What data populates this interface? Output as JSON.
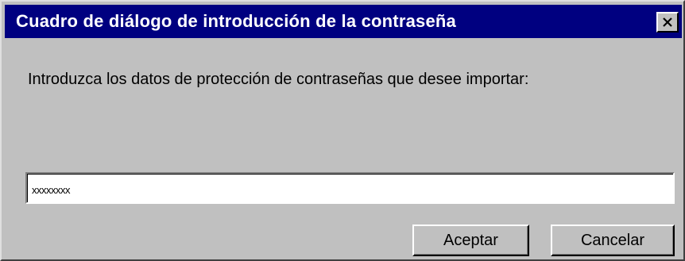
{
  "dialog": {
    "title": "Cuadro de diálogo de introducción de la contraseña",
    "close_icon": "close-icon",
    "prompt": "Introduzca los datos de protección de contraseñas que desee importar:",
    "password_field": {
      "value": "xxxxxxxx"
    },
    "buttons": {
      "ok_label": "Aceptar",
      "cancel_label": "Cancelar"
    }
  },
  "colors": {
    "titlebar": "#000080",
    "face": "#c0c0c0"
  }
}
